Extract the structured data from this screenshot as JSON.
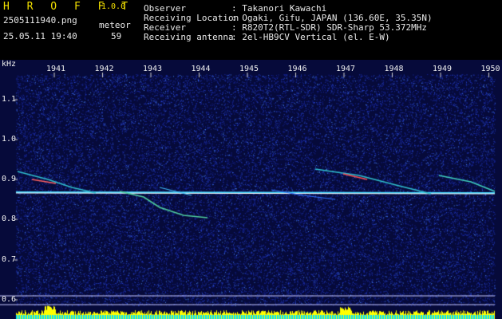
{
  "app": {
    "logo": "H R O F F T",
    "version": "1.0.0"
  },
  "file": {
    "name": "2505111940.png",
    "datetime": "25.05.11 19:40",
    "mode": "meteor",
    "count": "59"
  },
  "info": {
    "observer_label": "Observer",
    "observer_value": ": Takanori Kawachi",
    "location_label": "Receiving Location",
    "location_value": ": Ogaki, Gifu, JAPAN (136.60E, 35.35N)",
    "receiver_label": "Receiver",
    "receiver_value": ": R820T2(RTL-SDR) SDR-Sharp 53.372MHz",
    "antenna_label": "Receiving antenna",
    "antenna_value": ": 2el-HB9CV Vertical (el. E-W)"
  },
  "axis": {
    "unit": "kHz",
    "y_ticks": [
      "1.1",
      "1.0",
      "0.9",
      "0.8",
      "0.7",
      "0.6"
    ],
    "x_ticks": [
      "1941",
      "1942",
      "1943",
      "1944",
      "1945",
      "1946",
      "1947",
      "1948",
      "1949",
      "1950"
    ]
  },
  "colors": {
    "background": "#000000",
    "noise": "#1a2aa8",
    "signal": "#00e0e0",
    "header_yellow": "#f2e000"
  }
}
